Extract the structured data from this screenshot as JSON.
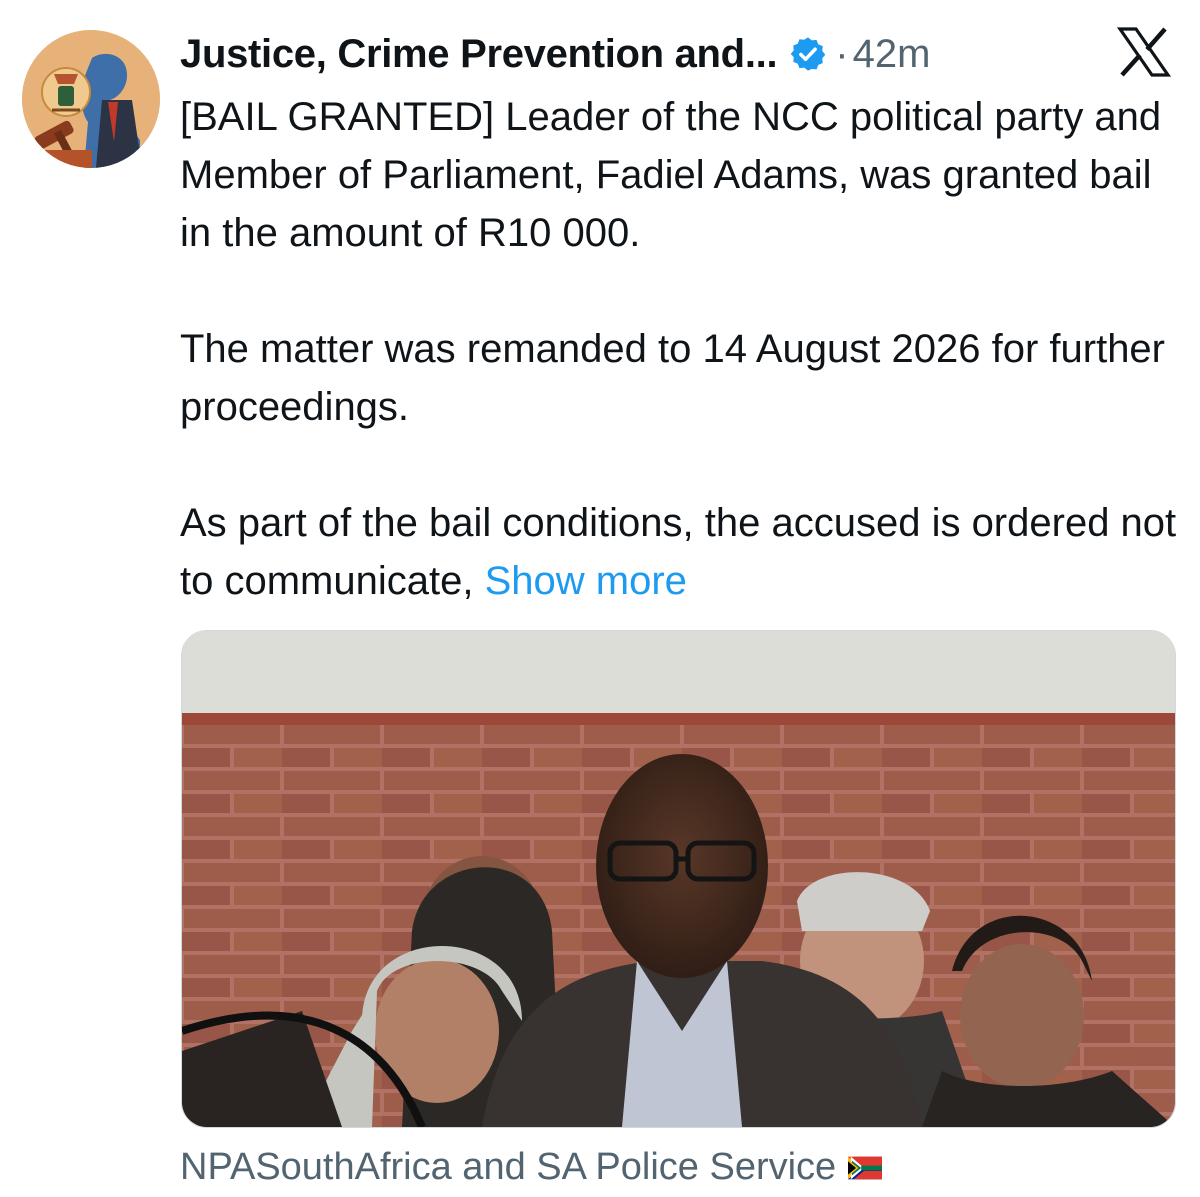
{
  "tweet": {
    "author_name": "Justice, Crime Prevention and...",
    "verified_badge_icon": "verified-badge-icon",
    "separator": "·",
    "timestamp": "42m",
    "platform_logo_icon": "x-logo-icon",
    "paragraphs": [
      "[BAIL GRANTED] Leader of the NCC political party and Member of Parliament, Fadiel Adams, was granted bail in the amount of R10 000.",
      "The matter was remanded to 14 August 2026 for further proceedings."
    ],
    "last_paragraph": "As part of the bail conditions, the accused is ordered not to communicate, ",
    "show_more": "Show more",
    "tagged_accounts": "NPASouthAfrica and SA Police Service",
    "flag_icon": "south-africa-flag-icon"
  },
  "colors": {
    "text": "#0f1419",
    "secondary": "#536471",
    "link": "#1d9bf0",
    "badge": "#1d9bf0"
  }
}
